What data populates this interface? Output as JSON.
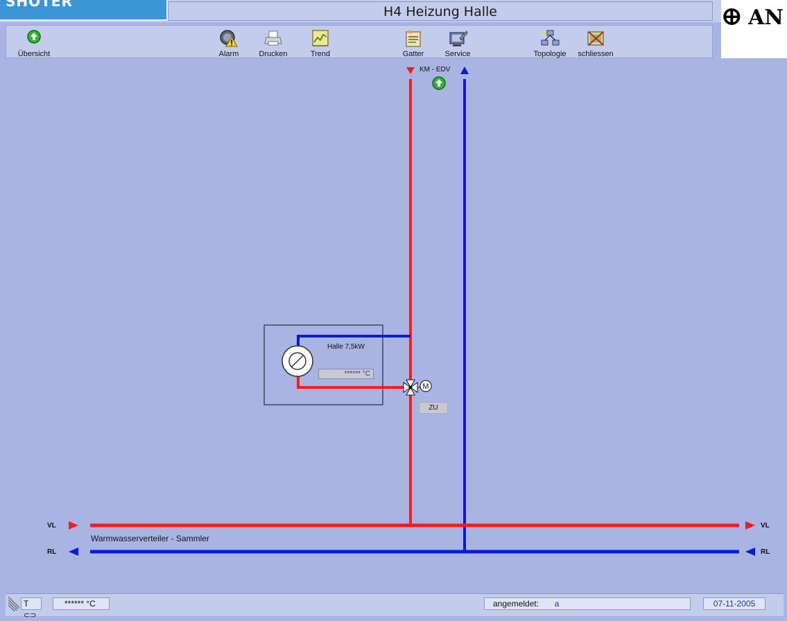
{
  "header": {
    "title": "H4 Heizung Halle",
    "brand_logo_text": "SHOTER",
    "right_logo_text": "ⴲ AN"
  },
  "toolbar": {
    "items": [
      {
        "label": "Übersicht",
        "icon": "up-arrow-icon"
      },
      {
        "label": "Alarm",
        "icon": "alarm-icon"
      },
      {
        "label": "Drucken",
        "icon": "printer-icon"
      },
      {
        "label": "Trend",
        "icon": "trend-icon"
      },
      {
        "label": "Gatter",
        "icon": "gatter-icon"
      },
      {
        "label": "Service",
        "icon": "service-icon"
      },
      {
        "label": "Topologie",
        "icon": "topology-icon"
      },
      {
        "label": "schliessen",
        "icon": "close-icon"
      }
    ]
  },
  "diagram": {
    "source_label": "KM - EDV",
    "heater": {
      "label": "Halle 7,5kW",
      "temp_value": "****** °C"
    },
    "valve_state": "ZU",
    "distributor_label": "Warmwasserverteiler - Sammler",
    "vl_label": "VL",
    "rl_label": "RL",
    "colors": {
      "supply": "#ff1a1a",
      "return": "#0a1ad6",
      "background": "#a9b4e3"
    }
  },
  "statusbar": {
    "temp_mode": "T",
    "temp_value": "****** °C",
    "logged_in_label": "angemeldet:",
    "logged_in_user": "a",
    "date": "07-11-2005"
  }
}
